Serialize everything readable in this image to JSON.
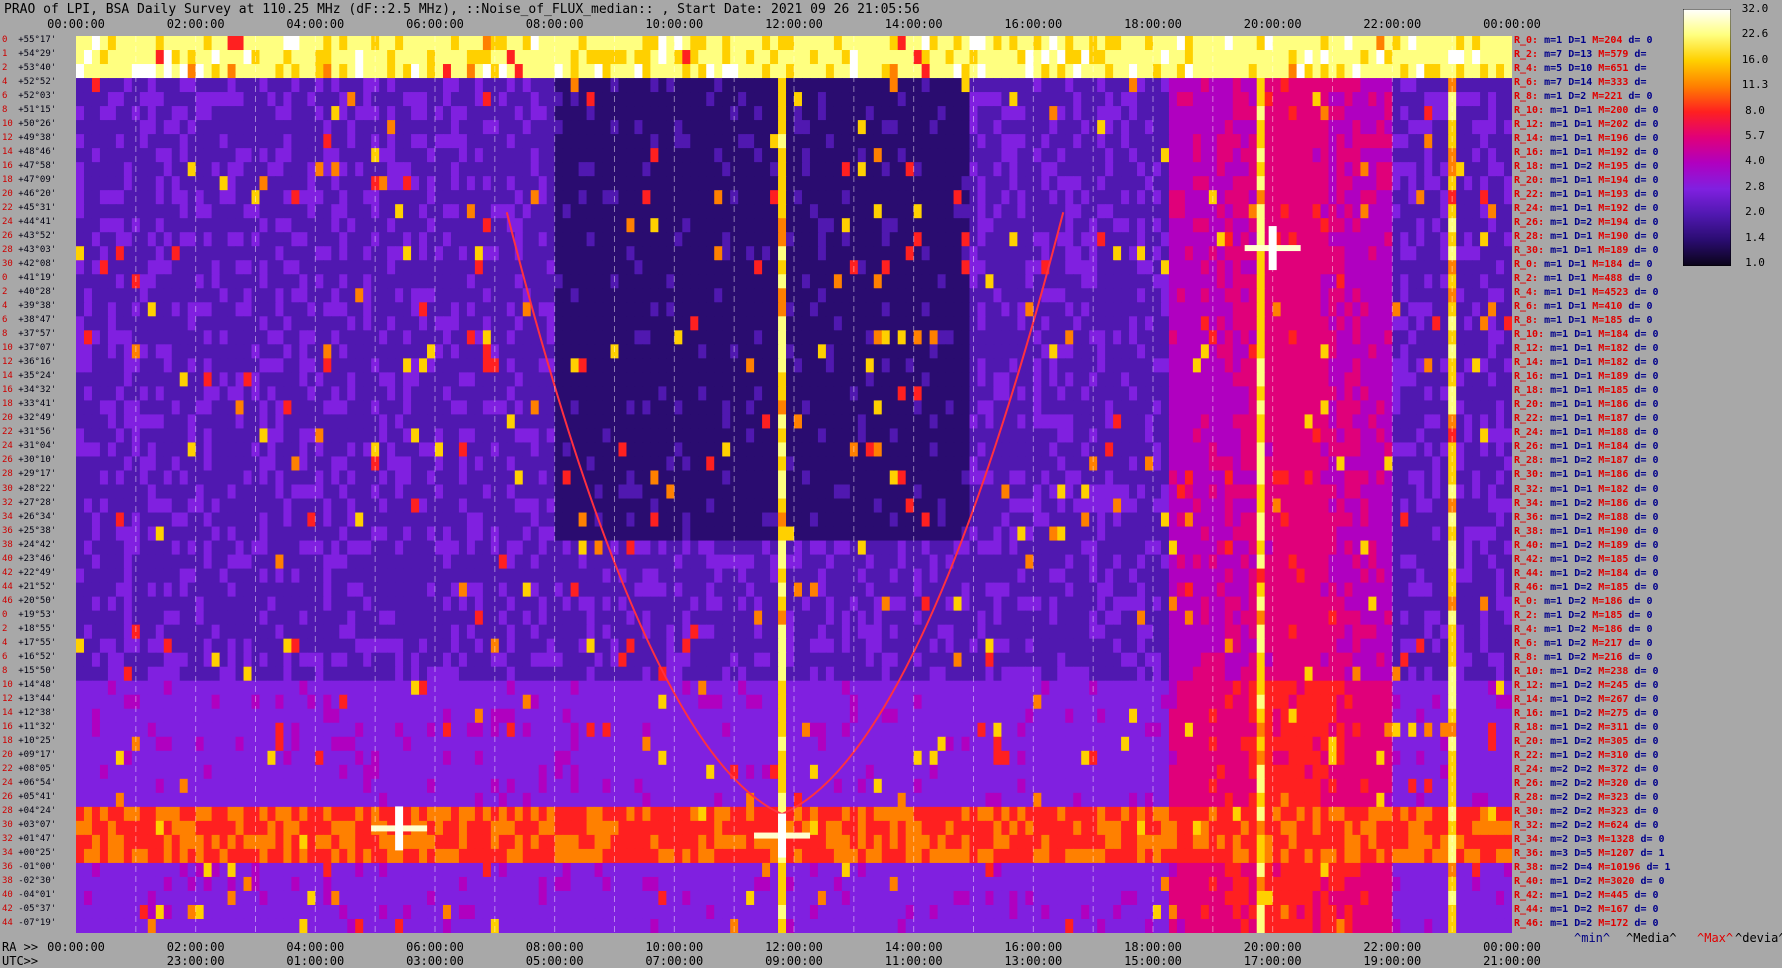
{
  "title": "PRAO of LPI, BSA Daily Survey at 110.25 MHz (dF::2.5 MHz), ::Noise_of_FLUX_median:: , Start Date: 2021 09 26 21:05:56",
  "colorbar": {
    "labels": [
      "32.0",
      "22.6",
      "16.0",
      "11.3",
      "8.0",
      "5.7",
      "4.0",
      "2.8",
      "2.0",
      "1.4",
      "1.0"
    ],
    "colors": [
      "#ffffff",
      "#ffff80",
      "#ffd000",
      "#ff8000",
      "#ff2020",
      "#e0007a",
      "#b000c0",
      "#8020e0",
      "#5018b0",
      "#2a0c70",
      "#0a0418"
    ]
  },
  "axes": {
    "top_ticks": [
      "00:00:00",
      "02:00:00",
      "04:00:00",
      "06:00:00",
      "08:00:00",
      "10:00:00",
      "12:00:00",
      "14:00:00",
      "16:00:00",
      "18:00:00",
      "20:00:00",
      "22:00:00",
      "00:00:00"
    ],
    "bottom_ra_prefix": "RA >>",
    "bottom_ra_ticks": [
      "00:00:00",
      "02:00:00",
      "04:00:00",
      "06:00:00",
      "08:00:00",
      "10:00:00",
      "12:00:00",
      "14:00:00",
      "16:00:00",
      "18:00:00",
      "20:00:00",
      "22:00:00",
      "00:00:00"
    ],
    "bottom_utc_prefix": "UTC>>",
    "bottom_utc_ticks": [
      "23:00:00",
      "01:00:00",
      "03:00:00",
      "05:00:00",
      "07:00:00",
      "09:00:00",
      "11:00:00",
      "13:00:00",
      "15:00:00",
      "17:00:00",
      "19:00:00",
      "21:00:00"
    ]
  },
  "legend": {
    "min": "^min^",
    "median": "^Media^",
    "max": "^Max^",
    "devia": "^devia^"
  },
  "declinations": [
    {
      "i": "0",
      "d": "+55°17'"
    },
    {
      "i": "1",
      "d": "+54°29'"
    },
    {
      "i": "2",
      "d": "+53°40'"
    },
    {
      "i": "4",
      "d": "+52°52'"
    },
    {
      "i": "6",
      "d": "+52°03'"
    },
    {
      "i": "8",
      "d": "+51°15'"
    },
    {
      "i": "10",
      "d": "+50°26'"
    },
    {
      "i": "12",
      "d": "+49°38'"
    },
    {
      "i": "14",
      "d": "+48°46'"
    },
    {
      "i": "16",
      "d": "+47°58'"
    },
    {
      "i": "18",
      "d": "+47°09'"
    },
    {
      "i": "20",
      "d": "+46°20'"
    },
    {
      "i": "22",
      "d": "+45°31'"
    },
    {
      "i": "24",
      "d": "+44°41'"
    },
    {
      "i": "26",
      "d": "+43°52'"
    },
    {
      "i": "28",
      "d": "+43°03'"
    },
    {
      "i": "30",
      "d": "+42°08'"
    },
    {
      "i": "0",
      "d": "+41°19'"
    },
    {
      "i": "2",
      "d": "+40°28'"
    },
    {
      "i": "4",
      "d": "+39°38'"
    },
    {
      "i": "6",
      "d": "+38°47'"
    },
    {
      "i": "8",
      "d": "+37°57'"
    },
    {
      "i": "10",
      "d": "+37°07'"
    },
    {
      "i": "12",
      "d": "+36°16'"
    },
    {
      "i": "14",
      "d": "+35°24'"
    },
    {
      "i": "16",
      "d": "+34°32'"
    },
    {
      "i": "18",
      "d": "+33°41'"
    },
    {
      "i": "20",
      "d": "+32°49'"
    },
    {
      "i": "22",
      "d": "+31°56'"
    },
    {
      "i": "24",
      "d": "+31°04'"
    },
    {
      "i": "26",
      "d": "+30°10'"
    },
    {
      "i": "28",
      "d": "+29°17'"
    },
    {
      "i": "30",
      "d": "+28°22'"
    },
    {
      "i": "32",
      "d": "+27°28'"
    },
    {
      "i": "34",
      "d": "+26°34'"
    },
    {
      "i": "36",
      "d": "+25°38'"
    },
    {
      "i": "38",
      "d": "+24°42'"
    },
    {
      "i": "40",
      "d": "+23°46'"
    },
    {
      "i": "42",
      "d": "+22°49'"
    },
    {
      "i": "44",
      "d": "+21°52'"
    },
    {
      "i": "46",
      "d": "+20°50'"
    },
    {
      "i": "0",
      "d": "+19°53'"
    },
    {
      "i": "2",
      "d": "+18°55'"
    },
    {
      "i": "4",
      "d": "+17°55'"
    },
    {
      "i": "6",
      "d": "+16°52'"
    },
    {
      "i": "8",
      "d": "+15°50'"
    },
    {
      "i": "10",
      "d": "+14°48'"
    },
    {
      "i": "12",
      "d": "+13°44'"
    },
    {
      "i": "14",
      "d": "+12°38'"
    },
    {
      "i": "16",
      "d": "+11°32'"
    },
    {
      "i": "18",
      "d": "+10°25'"
    },
    {
      "i": "20",
      "d": "+09°17'"
    },
    {
      "i": "22",
      "d": "+08°05'"
    },
    {
      "i": "24",
      "d": "+06°54'"
    },
    {
      "i": "26",
      "d": "+05°41'"
    },
    {
      "i": "28",
      "d": "+04°24'"
    },
    {
      "i": "30",
      "d": "+03°07'"
    },
    {
      "i": "32",
      "d": "+01°47'"
    },
    {
      "i": "34",
      "d": "+00°25'"
    },
    {
      "i": "36",
      "d": "-01°00'"
    },
    {
      "i": "38",
      "d": "-02°30'"
    },
    {
      "i": "40",
      "d": "-04°01'"
    },
    {
      "i": "42",
      "d": "-05°37'"
    },
    {
      "i": "44",
      "d": "-07°19'"
    }
  ],
  "stats_rows": [
    {
      "r": "R_0:",
      "m": "m=1",
      "D": "D=1",
      "M": "M=204",
      "d": "d= 0"
    },
    {
      "r": "R_2:",
      "m": "m=7",
      "D": "D=13",
      "M": "M=579",
      "d": "d="
    },
    {
      "r": "R_4:",
      "m": "m=5",
      "D": "D=10",
      "M": "M=651",
      "d": "d="
    },
    {
      "r": "R_6:",
      "m": "m=7",
      "D": "D=14",
      "M": "M=333",
      "d": "d="
    },
    {
      "r": "R_8:",
      "m": "m=1",
      "D": "D=2",
      "M": "M=221",
      "d": "d= 0"
    },
    {
      "r": "R_10:",
      "m": "m=1",
      "D": "D=1",
      "M": "M=200",
      "d": "d= 0"
    },
    {
      "r": "R_12:",
      "m": "m=1",
      "D": "D=1",
      "M": "M=202",
      "d": "d= 0"
    },
    {
      "r": "R_14:",
      "m": "m=1",
      "D": "D=1",
      "M": "M=196",
      "d": "d= 0"
    },
    {
      "r": "R_16:",
      "m": "m=1",
      "D": "D=1",
      "M": "M=192",
      "d": "d= 0"
    },
    {
      "r": "R_18:",
      "m": "m=1",
      "D": "D=2",
      "M": "M=195",
      "d": "d= 0"
    },
    {
      "r": "R_20:",
      "m": "m=1",
      "D": "D=1",
      "M": "M=194",
      "d": "d= 0"
    },
    {
      "r": "R_22:",
      "m": "m=1",
      "D": "D=1",
      "M": "M=193",
      "d": "d= 0"
    },
    {
      "r": "R_24:",
      "m": "m=1",
      "D": "D=1",
      "M": "M=192",
      "d": "d= 0"
    },
    {
      "r": "R_26:",
      "m": "m=1",
      "D": "D=2",
      "M": "M=194",
      "d": "d= 0"
    },
    {
      "r": "R_28:",
      "m": "m=1",
      "D": "D=1",
      "M": "M=190",
      "d": "d= 0"
    },
    {
      "r": "R_30:",
      "m": "m=1",
      "D": "D=1",
      "M": "M=189",
      "d": "d= 0"
    },
    {
      "r": "R_0:",
      "m": "m=1",
      "D": "D=1",
      "M": "M=184",
      "d": "d= 0"
    },
    {
      "r": "R_2:",
      "m": "m=1",
      "D": "D=1",
      "M": "M=488",
      "d": "d= 0"
    },
    {
      "r": "R_4:",
      "m": "m=1",
      "D": "D=1",
      "M": "M=4523",
      "d": "d= 0"
    },
    {
      "r": "R_6:",
      "m": "m=1",
      "D": "D=1",
      "M": "M=410",
      "d": "d= 0"
    },
    {
      "r": "R_8:",
      "m": "m=1",
      "D": "D=1",
      "M": "M=185",
      "d": "d= 0"
    },
    {
      "r": "R_10:",
      "m": "m=1",
      "D": "D=1",
      "M": "M=184",
      "d": "d= 0"
    },
    {
      "r": "R_12:",
      "m": "m=1",
      "D": "D=1",
      "M": "M=182",
      "d": "d= 0"
    },
    {
      "r": "R_14:",
      "m": "m=1",
      "D": "D=1",
      "M": "M=182",
      "d": "d= 0"
    },
    {
      "r": "R_16:",
      "m": "m=1",
      "D": "D=1",
      "M": "M=189",
      "d": "d= 0"
    },
    {
      "r": "R_18:",
      "m": "m=1",
      "D": "D=1",
      "M": "M=185",
      "d": "d= 0"
    },
    {
      "r": "R_20:",
      "m": "m=1",
      "D": "D=1",
      "M": "M=186",
      "d": "d= 0"
    },
    {
      "r": "R_22:",
      "m": "m=1",
      "D": "D=1",
      "M": "M=187",
      "d": "d= 0"
    },
    {
      "r": "R_24:",
      "m": "m=1",
      "D": "D=1",
      "M": "M=188",
      "d": "d= 0"
    },
    {
      "r": "R_26:",
      "m": "m=1",
      "D": "D=1",
      "M": "M=184",
      "d": "d= 0"
    },
    {
      "r": "R_28:",
      "m": "m=1",
      "D": "D=2",
      "M": "M=187",
      "d": "d= 0"
    },
    {
      "r": "R_30:",
      "m": "m=1",
      "D": "D=1",
      "M": "M=186",
      "d": "d= 0"
    },
    {
      "r": "R_32:",
      "m": "m=1",
      "D": "D=1",
      "M": "M=182",
      "d": "d= 0"
    },
    {
      "r": "R_34:",
      "m": "m=1",
      "D": "D=2",
      "M": "M=186",
      "d": "d= 0"
    },
    {
      "r": "R_36:",
      "m": "m=1",
      "D": "D=2",
      "M": "M=188",
      "d": "d= 0"
    },
    {
      "r": "R_38:",
      "m": "m=1",
      "D": "D=1",
      "M": "M=190",
      "d": "d= 0"
    },
    {
      "r": "R_40:",
      "m": "m=1",
      "D": "D=2",
      "M": "M=189",
      "d": "d= 0"
    },
    {
      "r": "R_42:",
      "m": "m=1",
      "D": "D=2",
      "M": "M=185",
      "d": "d= 0"
    },
    {
      "r": "R_44:",
      "m": "m=1",
      "D": "D=2",
      "M": "M=184",
      "d": "d= 0"
    },
    {
      "r": "R_46:",
      "m": "m=1",
      "D": "D=2",
      "M": "M=185",
      "d": "d= 0"
    },
    {
      "r": "R_0:",
      "m": "m=1",
      "D": "D=2",
      "M": "M=186",
      "d": "d= 0"
    },
    {
      "r": "R_2:",
      "m": "m=1",
      "D": "D=2",
      "M": "M=185",
      "d": "d= 0"
    },
    {
      "r": "R_4:",
      "m": "m=1",
      "D": "D=2",
      "M": "M=186",
      "d": "d= 0"
    },
    {
      "r": "R_6:",
      "m": "m=1",
      "D": "D=2",
      "M": "M=217",
      "d": "d= 0"
    },
    {
      "r": "R_8:",
      "m": "m=1",
      "D": "D=2",
      "M": "M=216",
      "d": "d= 0"
    },
    {
      "r": "R_10:",
      "m": "m=1",
      "D": "D=2",
      "M": "M=238",
      "d": "d= 0"
    },
    {
      "r": "R_12:",
      "m": "m=1",
      "D": "D=2",
      "M": "M=245",
      "d": "d= 0"
    },
    {
      "r": "R_14:",
      "m": "m=1",
      "D": "D=2",
      "M": "M=267",
      "d": "d= 0"
    },
    {
      "r": "R_16:",
      "m": "m=1",
      "D": "D=2",
      "M": "M=275",
      "d": "d= 0"
    },
    {
      "r": "R_18:",
      "m": "m=1",
      "D": "D=2",
      "M": "M=311",
      "d": "d= 0"
    },
    {
      "r": "R_20:",
      "m": "m=1",
      "D": "D=2",
      "M": "M=305",
      "d": "d= 0"
    },
    {
      "r": "R_22:",
      "m": "m=1",
      "D": "D=2",
      "M": "M=310",
      "d": "d= 0"
    },
    {
      "r": "R_24:",
      "m": "m=2",
      "D": "D=2",
      "M": "M=372",
      "d": "d= 0"
    },
    {
      "r": "R_26:",
      "m": "m=2",
      "D": "D=2",
      "M": "M=320",
      "d": "d= 0"
    },
    {
      "r": "R_28:",
      "m": "m=2",
      "D": "D=2",
      "M": "M=323",
      "d": "d= 0"
    },
    {
      "r": "R_30:",
      "m": "m=2",
      "D": "D=2",
      "M": "M=323",
      "d": "d= 0"
    },
    {
      "r": "R_32:",
      "m": "m=2",
      "D": "D=2",
      "M": "M=624",
      "d": "d= 0"
    },
    {
      "r": "R_34:",
      "m": "m=2",
      "D": "D=3",
      "M": "M=1328",
      "d": "d= 0"
    },
    {
      "r": "R_36:",
      "m": "m=3",
      "D": "D=5",
      "M": "M=1207",
      "d": "d= 1"
    },
    {
      "r": "R_38:",
      "m": "m=2",
      "D": "D=4",
      "M": "M=10196",
      "d": "d= 1"
    },
    {
      "r": "R_40:",
      "m": "m=1",
      "D": "D=2",
      "M": "M=3020",
      "d": "d= 0"
    },
    {
      "r": "R_42:",
      "m": "m=1",
      "D": "D=2",
      "M": "M=445",
      "d": "d= 0"
    },
    {
      "r": "R_44:",
      "m": "m=1",
      "D": "D=2",
      "M": "M=167",
      "d": "d= 0"
    },
    {
      "r": "R_46:",
      "m": "m=1",
      "D": "D=2",
      "M": "M=172",
      "d": "d= 0"
    }
  ],
  "chart_data": {
    "type": "heatmap",
    "title": "PRAO of LPI, BSA Daily Survey at 110.25 MHz (dF::2.5 MHz), ::Noise_of_FLUX_median:: , Start Date: 2021 09 26 21:05:56",
    "x_axis": "RA (hours), 00:00:00 to 24:00:00",
    "x_range_hours": [
      0,
      24
    ],
    "y_axis": "Declination",
    "y_range": [
      "+55°17'",
      "-07°19'"
    ],
    "color_scale": [
      1.0,
      32.0
    ],
    "color_scale_log": true,
    "features": {
      "top_bright_band_decl_deg": [
        52,
        55
      ],
      "equatorial_band_decl_deg": [
        -2,
        1
      ],
      "vertical_bright_tracks_ra_hours": [
        11.8,
        19.8,
        23.0
      ],
      "bright_source_ra_dec": [
        {
          "ra": 20.0,
          "dec": 40.5
        },
        {
          "ra": 11.8,
          "dec": -0.5
        },
        {
          "ra": 5.4,
          "dec": 0.0
        }
      ],
      "satellite_arcs_ra_hours": [
        [
          7.2,
          11.8
        ],
        [
          11.8,
          16.5
        ]
      ]
    }
  }
}
